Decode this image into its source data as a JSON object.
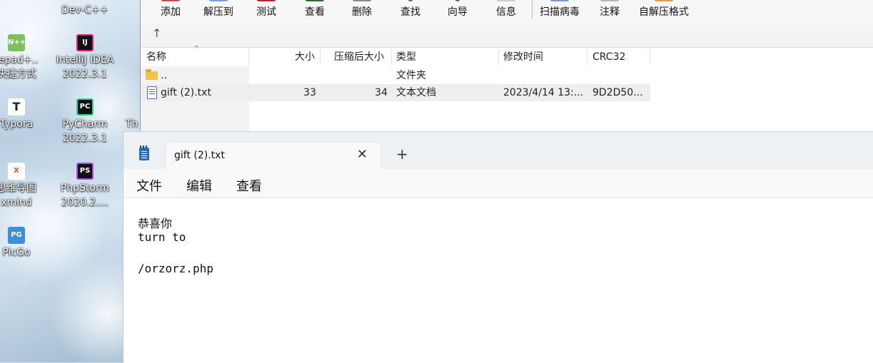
{
  "desktop": {
    "icons": [
      {
        "label_lines": [
          "",
          "tepad+..",
          "快捷方式"
        ],
        "glyph": "N++",
        "color": "#6aa84f"
      },
      {
        "label_lines": [
          "",
          "IntelliJ IDEA",
          "2022.3.1"
        ],
        "glyph": "IJ",
        "color": "#d4256c"
      },
      {
        "label_lines": [
          "",
          "Typora"
        ],
        "glyph": "T",
        "color": "#ffffff"
      },
      {
        "label_lines": [
          "",
          "PyCharm",
          "2022.3.1"
        ],
        "glyph": "PC",
        "color": "#21d789"
      },
      {
        "label_lines": [
          "",
          "思维导图",
          "xmind"
        ],
        "glyph": "X",
        "color": "#e74c3c"
      },
      {
        "label_lines": [
          "",
          "PhpStorm",
          "2020.2...."
        ],
        "glyph": "PS",
        "color": "#b345f1"
      },
      {
        "label_lines": [
          "",
          "PicGo"
        ],
        "glyph": "PG",
        "color": "#3b8fe0"
      }
    ],
    "partial_top_labels": [
      "Dev-C++"
    ],
    "partial_label_th": "Th"
  },
  "archiver": {
    "toolbar": {
      "buttons": [
        "添加",
        "解压到",
        "测试",
        "查看",
        "删除",
        "查找",
        "向导",
        "信息",
        "扫描病毒",
        "注释",
        "自解压格式"
      ]
    },
    "columns": [
      "名称",
      "大小",
      "压缩后大小",
      "类型",
      "修改时间",
      "CRC32"
    ],
    "rows": [
      {
        "name": "..",
        "size": "",
        "packed": "",
        "type": "文件夹",
        "modified": "",
        "crc": ""
      },
      {
        "name": "gift (2).txt",
        "size": "33",
        "packed": "34",
        "type": "文本文档",
        "modified": "2023/4/14 13:...",
        "crc": "9D2D50..."
      }
    ]
  },
  "notepad": {
    "tab_title": "gift (2).txt",
    "menu": [
      "文件",
      "编辑",
      "查看"
    ],
    "content_lines": [
      "恭喜你",
      "turn to",
      "",
      "/orzorz.php"
    ]
  }
}
